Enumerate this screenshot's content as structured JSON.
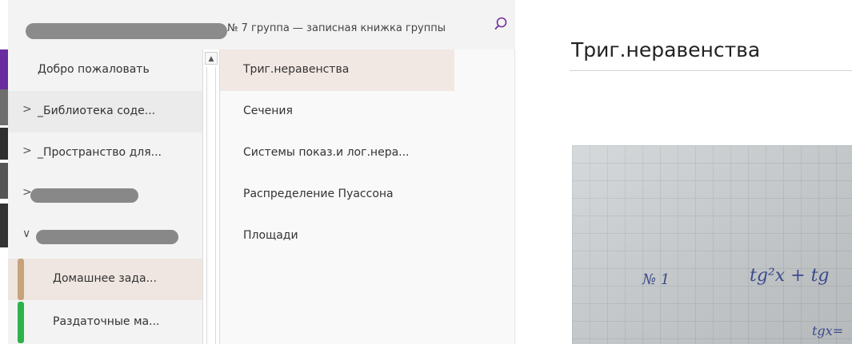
{
  "header": {
    "notebook_title": "№ 7 группа — записная книжка группы"
  },
  "sections": [
    {
      "label": "Добро пожаловать",
      "chevron": ""
    },
    {
      "label": "_Библиотека соде...",
      "chevron": ">"
    },
    {
      "label": "_Пространство для...",
      "chevron": ">"
    },
    {
      "label": "",
      "chevron": ">"
    },
    {
      "label": "",
      "chevron": "∨"
    },
    {
      "label": "Домашнее зада...",
      "color": "#c8a27a"
    },
    {
      "label": "Раздаточные ма...",
      "color": "#2cb34a"
    }
  ],
  "pages": [
    {
      "label": "Триг.неравенства"
    },
    {
      "label": "Сечения"
    },
    {
      "label": "Системы показ.и лог.нера..."
    },
    {
      "label": "Распределение Пуассона"
    },
    {
      "label": "Площади"
    }
  ],
  "content": {
    "page_title": "Триг.неравенства",
    "photo_text_1": "№ 1",
    "photo_text_2": "tg²x + tg",
    "photo_text_3": "tgx="
  },
  "colors": {
    "accent_purple": "#7030a0",
    "active_section_bg": "#efe6e1",
    "active_page_bg": "#f1e8e4"
  }
}
